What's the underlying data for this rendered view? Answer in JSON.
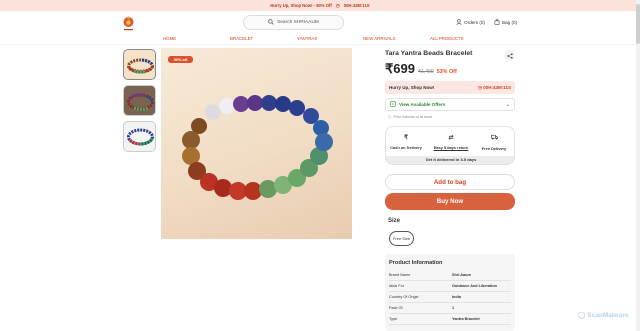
{
  "topbar": {
    "hurry": "Hurry Up, Shop Now! - 60% Off",
    "timer": "00H:43M:11S"
  },
  "header": {
    "search_placeholder": "Search SHRIAAUM",
    "orders_label": "Orders (0)",
    "bag_label": "Bag (0)"
  },
  "nav": {
    "items": [
      "HOME",
      "BRACELET",
      "YANTRAS",
      "NEW ARRIVALS",
      "ALL PRODUCTS"
    ]
  },
  "gallery": {
    "discount_badge": "50% off"
  },
  "product": {
    "title": "Tara Yantra Beads Bracelet",
    "price": "₹699",
    "mrp": "₹1,499",
    "discount": "53% Off",
    "hurry_label": "Hurry Up, Shop Now!",
    "hurry_timer": "00H:43M:11S",
    "offers_label": "View Available Offers",
    "note": "Price inclusive of all taxes",
    "delivery": {
      "cod": "Cash on Delivery",
      "returns": "Easy 5 days return",
      "free": "Free Delivery",
      "eta": "Get it delivered in 3-5 days"
    },
    "add_to_bag": "Add to bag",
    "buy_now": "Buy Now",
    "size_heading": "Size",
    "size_option": "Free Size"
  },
  "info": {
    "heading": "Product Information",
    "rows": [
      {
        "k": "Brand Name",
        "v": "Shri Aaum"
      },
      {
        "k": "Ideal For",
        "v": "Guidance And Liberation"
      },
      {
        "k": "Country Of Origin",
        "v": "India"
      },
      {
        "k": "Pack Of",
        "v": "1"
      },
      {
        "k": "Type",
        "v": "Yantra Bracelet"
      }
    ]
  },
  "watermark": "ScanMalware",
  "colors": {
    "accent": "#d1421e",
    "buy": "#d9623e",
    "banner": "#fbe3dc"
  }
}
